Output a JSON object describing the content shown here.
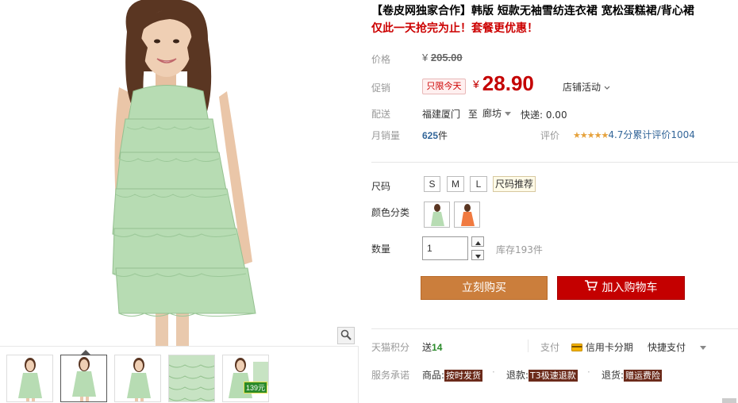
{
  "product": {
    "title": "【卷皮网独家合作】韩版 短款无袖雪纺连衣裙 宽松蛋糕裙/背心裙",
    "subtitle": "仅此一天抢完为止！套餐更优惠！"
  },
  "price": {
    "label": "价格",
    "currency": "¥",
    "original": "205.00"
  },
  "promo": {
    "label": "促销",
    "badge": "只限今天",
    "currency": "¥",
    "price": "28.90",
    "shop_activity": "店铺活动",
    "shop_activity_icon": "chevron-down-icon"
  },
  "shipping": {
    "label": "配送",
    "from": "福建厦门",
    "to_word": "至",
    "destination": "廊坊",
    "fee": "快递: 0.00"
  },
  "sales": {
    "label": "月销量",
    "count": "625",
    "unit": "件",
    "rating_label": "评价",
    "stars": "★★★★★",
    "rating_score": "4.7分",
    "rating_total": "累计评价1004"
  },
  "size": {
    "label": "尺码",
    "options": [
      "S",
      "M",
      "L"
    ],
    "guide": "尺码推荐"
  },
  "color": {
    "label": "颜色分类",
    "swatches": [
      "green",
      "orange"
    ]
  },
  "quantity": {
    "label": "数量",
    "value": "1",
    "stock": "库存193件"
  },
  "actions": {
    "buy_now": "立刻购买",
    "add_to_cart": "加入购物车",
    "cart_icon": "cart-icon"
  },
  "points": {
    "label": "天猫积分",
    "prefix": "送",
    "value": "14"
  },
  "payment": {
    "label": "支付",
    "credit": "信用卡分期",
    "quick": "快捷支付"
  },
  "service": {
    "label": "服务承诺",
    "items": [
      {
        "prefix": "商品:",
        "tag": "按时发货"
      },
      {
        "prefix": "退款:",
        "tag": "T3极速退款"
      },
      {
        "prefix": "退货:",
        "tag": "赠运费险"
      }
    ]
  },
  "gallery": {
    "thumb_price_tag": "139元",
    "zoom_icon": "magnifier-icon"
  },
  "colors": {
    "price_red": "#c40000",
    "buy_orange": "#cb7e3c",
    "dress_green": "#a9d4a6"
  }
}
